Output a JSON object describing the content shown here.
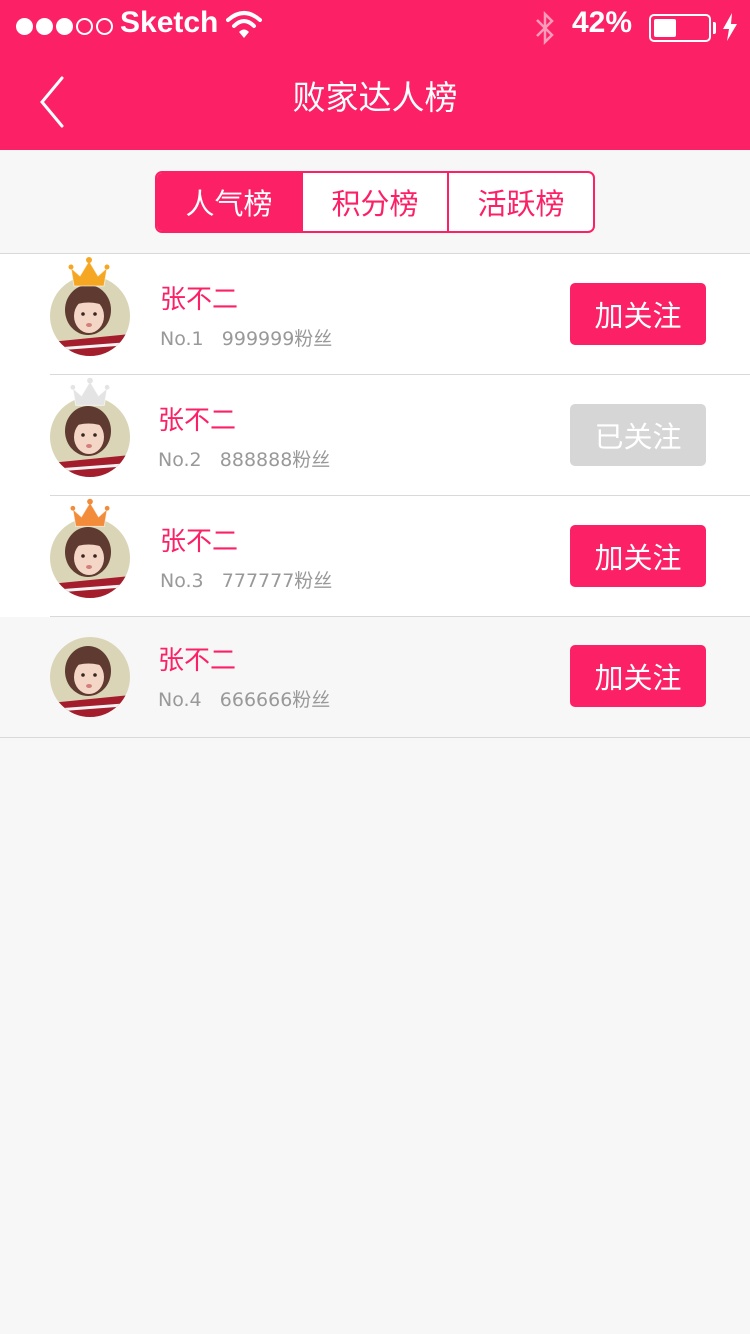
{
  "status_bar": {
    "carrier": "Sketch",
    "battery_percent": "42%",
    "battery_level": 0.42,
    "signal_full_dots": 3,
    "signal_total_dots": 5
  },
  "nav": {
    "title": "败家达人榜",
    "back_icon": "chevron-left-icon"
  },
  "tabs": [
    {
      "label": "人气榜",
      "active": true
    },
    {
      "label": "积分榜",
      "active": false
    },
    {
      "label": "活跃榜",
      "active": false
    }
  ],
  "list": [
    {
      "name": "张不二",
      "rank": "No.1",
      "fans": "999999粉丝",
      "button": "加关注",
      "followed": false,
      "crown": "gold"
    },
    {
      "name": "张不二",
      "rank": "No.2",
      "fans": "888888粉丝",
      "button": "已关注",
      "followed": true,
      "crown": "silver"
    },
    {
      "name": "张不二",
      "rank": "No.3",
      "fans": "777777粉丝",
      "button": "加关注",
      "followed": false,
      "crown": "bronze"
    },
    {
      "name": "张不二",
      "rank": "No.4",
      "fans": "666666粉丝",
      "button": "加关注",
      "followed": false,
      "crown": "none"
    }
  ],
  "colors": {
    "accent": "#fc2066",
    "followed_button": "#d6d6d6",
    "background": "#f8f7f8",
    "crown_gold": "#f5a623",
    "crown_silver": "#e4e4e4",
    "crown_bronze": "#f28c3a"
  }
}
